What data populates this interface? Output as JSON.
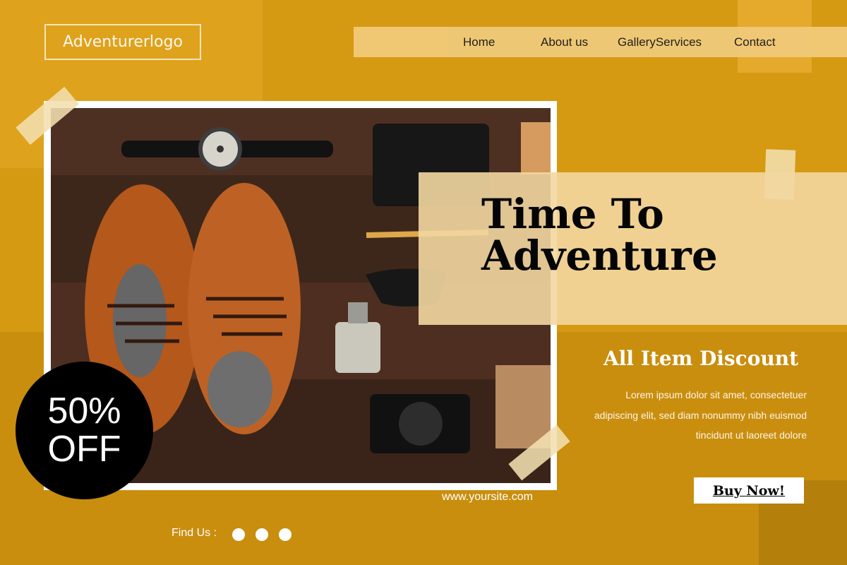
{
  "header": {
    "logo_text": "Adventurerlogo",
    "nav": [
      "Home",
      "About us",
      "GalleryServices",
      "Contact"
    ]
  },
  "hero": {
    "title_line1": "Time To",
    "title_line2": "Adventure",
    "subtitle": "All Item Discount",
    "description": "Lorem ipsum dolor sit amet, consectetuer adipiscing elit, sed diam nonummy nibh euismod tincidunt ut laoreet dolore",
    "cta_label": "Buy Now!",
    "website": "www.yoursite.com"
  },
  "badge": {
    "line1": "50%",
    "line2": "OFF"
  },
  "footer": {
    "find_us": "Find Us :"
  },
  "colors": {
    "background": "#d59a12",
    "accent": "#f3d7a1",
    "text_dark": "#050505"
  }
}
